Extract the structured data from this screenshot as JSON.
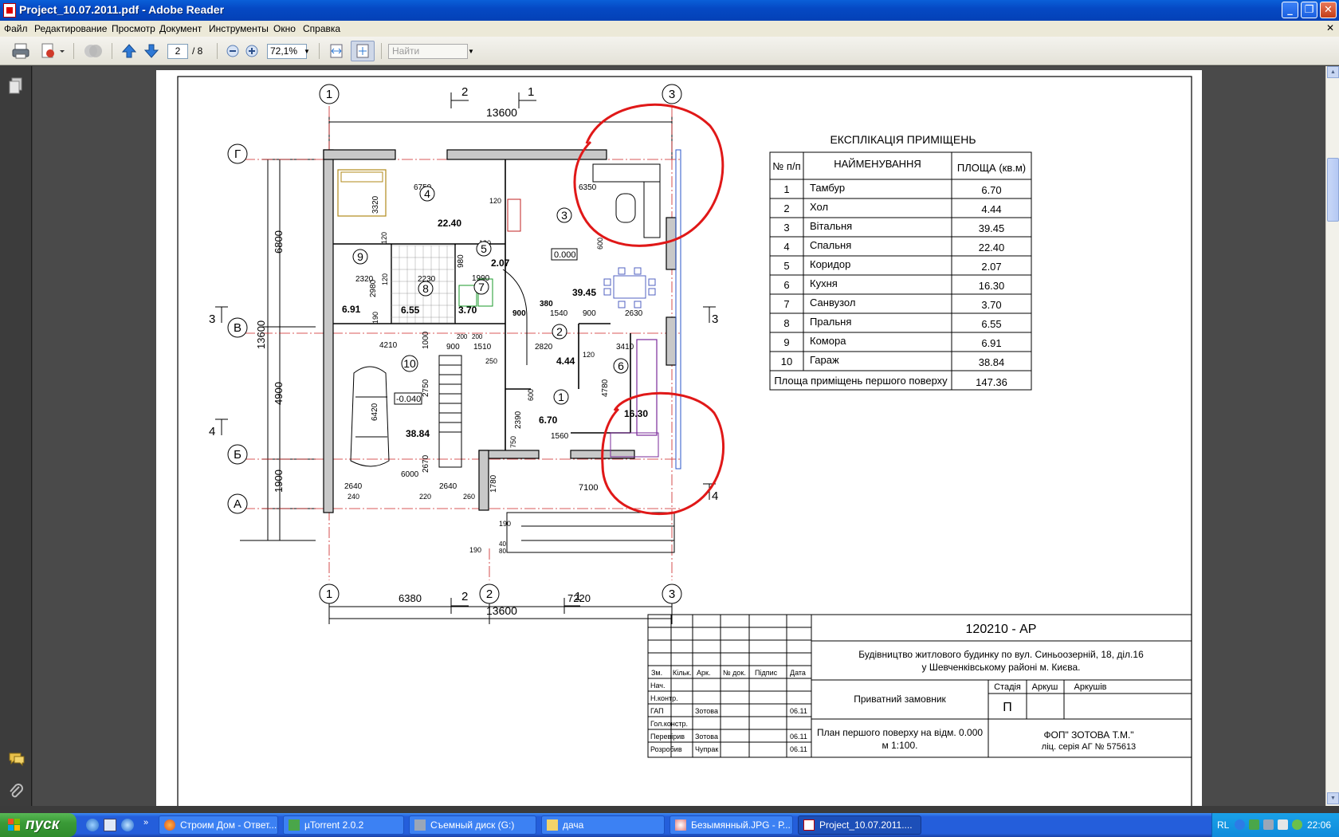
{
  "window": {
    "title": "Project_10.07.2011.pdf - Adobe Reader"
  },
  "menu": [
    "Файл",
    "Редактирование",
    "Просмотр",
    "Документ",
    "Инструменты",
    "Окно",
    "Справка"
  ],
  "toolbar": {
    "page_current": "2",
    "page_total": "/ 8",
    "zoom": "72,1%",
    "find_placeholder": "Найти"
  },
  "drawing": {
    "axes": {
      "col1": "1",
      "col2": "2",
      "col3": "3",
      "rowG": "Г",
      "rowV": "В",
      "rowB": "Б",
      "rowA": "А"
    },
    "sections": {
      "s1": "1",
      "s2": "2",
      "s3": "3",
      "s4": "4"
    },
    "dims": {
      "top_total": "13600",
      "bottom_total": "13600",
      "left_total": "13600",
      "left_6800": "6800",
      "left_4900": "4900",
      "left_1900": "1900",
      "bottom_6380": "6380",
      "bottom_7220": "7220",
      "d6750": "6750",
      "d6350": "6350",
      "d3320": "3320",
      "d2320": "2320",
      "d2230": "2230",
      "d2980": "2980",
      "d1990": "1990",
      "d980": "980",
      "d900a": "900",
      "d380": "380",
      "d1540": "1540",
      "d900b": "900",
      "d2630": "2630",
      "d4210": "4210",
      "d1000": "1000",
      "d900c": "900",
      "d1510": "1510",
      "d2820": "2820",
      "d3410": "3410",
      "d2750": "2750",
      "d6420": "6420",
      "d4780": "4780",
      "d2390": "2390",
      "d1560": "1560",
      "d6000": "6000",
      "d2640a": "2640",
      "d2640b": "2640",
      "d2670": "2670",
      "d1780": "1780",
      "d7100": "7100",
      "d120a": "120",
      "d120b": "120",
      "d120c": "120",
      "d120d": "120",
      "d120e": "120",
      "d190a": "190",
      "d190b": "190",
      "d190c": "190",
      "d250": "250",
      "d600": "600",
      "d750": "750",
      "d240": "240",
      "d220": "220",
      "d260": "260",
      "d40": "40",
      "d80": "80",
      "d200a": "200",
      "d200b": "200",
      "d600b": "600"
    },
    "rooms": {
      "r1": "1",
      "r2": "2",
      "r3": "3",
      "r4": "4",
      "r5": "5",
      "r6": "6",
      "r7": "7",
      "r8": "8",
      "r9": "9",
      "r10": "10",
      "a1": "6.70",
      "a2": "4.44",
      "a3": "39.45",
      "a4": "22.40",
      "a5": "2.07",
      "a6": "16.30",
      "a7": "3.70",
      "a8": "6.55",
      "a9": "6.91",
      "a10": "38.84",
      "lvl0": "0.000",
      "lvl_garage": "-0.040"
    }
  },
  "explication": {
    "title": "ЕКСПЛІКАЦІЯ ПРИМІЩЕНЬ",
    "headers": [
      "№ п/п",
      "НАЙМЕНУВАННЯ",
      "ПЛОЩА (кв.м)"
    ],
    "rows": [
      [
        "1",
        "Тамбур",
        "6.70"
      ],
      [
        "2",
        "Хол",
        "4.44"
      ],
      [
        "3",
        "Вітальня",
        "39.45"
      ],
      [
        "4",
        "Спальня",
        "22.40"
      ],
      [
        "5",
        "Коридор",
        "2.07"
      ],
      [
        "6",
        "Кухня",
        "16.30"
      ],
      [
        "7",
        "Санвузол",
        "3.70"
      ],
      [
        "8",
        "Пральня",
        "6.55"
      ],
      [
        "9",
        "Комора",
        "6.91"
      ],
      [
        "10",
        "Гараж",
        "38.84"
      ]
    ],
    "total_label": "Площа приміщень першого поверху",
    "total_value": "147.36"
  },
  "stamp": {
    "code": "120210 - АР",
    "project": "Будівництво житлового будинку по вул. Синьоозерній, 18, діл.16",
    "project2": "у Шевченківському районі м. Києва.",
    "col_heads": [
      "Зм.",
      "Кільк.",
      "Арк.",
      "№ док.",
      "Підпис",
      "Дата"
    ],
    "roles": [
      "Нач.",
      "Н.контр.",
      "ГАП",
      "Гол.констр.",
      "Перевірив",
      "Розробив"
    ],
    "gap_name": "Зотова",
    "gap_date": "06.11",
    "check_name": "Зотова",
    "check_date": "06.11",
    "dev_name": "Чупрак",
    "dev_date": "06.11",
    "customer": "Приватний замовник",
    "stage_head": "Стадія",
    "sheet_head": "Аркуш",
    "sheets_head": "Аркушів",
    "stage": "П",
    "sheet_title": "План першого поверху на відм. 0.000",
    "scale": "м 1:100.",
    "company": "ФОП\" ЗОТОВА Т.М.\"",
    "license": "ліц. серія АГ № 575613"
  },
  "taskbar": {
    "start": "пуск",
    "tasks": [
      "Строим Дом - Ответ...",
      "µTorrent 2.0.2",
      "Съемный диск (G:)",
      "дача",
      "Безымянный.JPG - Р...",
      "Project_10.07.2011...."
    ],
    "lang": "RL",
    "clock": "22:06"
  },
  "colors": {
    "titlebar": "#0549c4",
    "markup_red": "#e01818",
    "taskbar": "#245edb",
    "start": "#3a9a37",
    "docbg": "#4a4a4a"
  }
}
